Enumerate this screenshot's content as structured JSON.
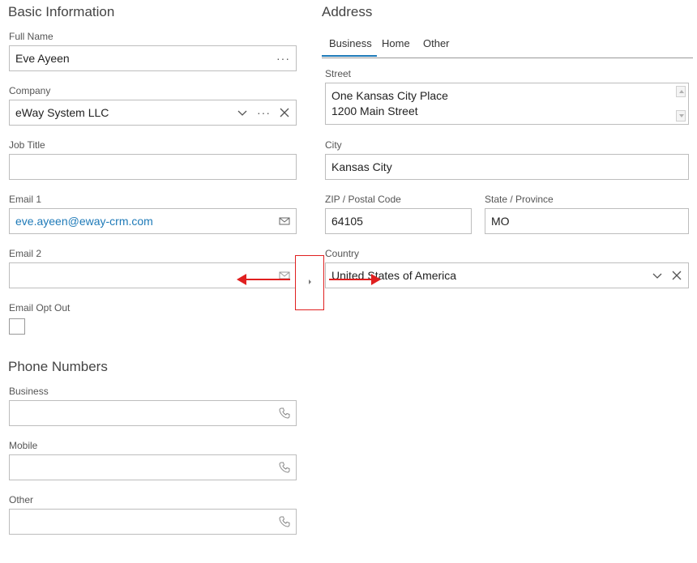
{
  "basic": {
    "title": "Basic Information",
    "full_name": {
      "label": "Full Name",
      "value": "Eve Ayeen"
    },
    "company": {
      "label": "Company",
      "value": "eWay System LLC"
    },
    "job_title": {
      "label": "Job Title",
      "value": ""
    },
    "email1": {
      "label": "Email 1",
      "value": "eve.ayeen@eway-crm.com"
    },
    "email2": {
      "label": "Email 2",
      "value": ""
    },
    "email_opt_out": {
      "label": "Email Opt Out",
      "checked": false
    }
  },
  "phones": {
    "title": "Phone Numbers",
    "business": {
      "label": "Business",
      "value": ""
    },
    "mobile": {
      "label": "Mobile",
      "value": ""
    },
    "other": {
      "label": "Other",
      "value": ""
    }
  },
  "address": {
    "title": "Address",
    "tabs": [
      {
        "label": "Business",
        "active": true
      },
      {
        "label": "Home",
        "active": false
      },
      {
        "label": "Other",
        "active": false
      }
    ],
    "street": {
      "label": "Street",
      "line1": "One Kansas City Place",
      "line2": "1200 Main Street"
    },
    "city": {
      "label": "City",
      "value": "Kansas City"
    },
    "zip": {
      "label": "ZIP / Postal Code",
      "value": "64105"
    },
    "state": {
      "label": "State / Province",
      "value": "MO"
    },
    "country": {
      "label": "Country",
      "value": "United States of America"
    }
  },
  "icons": {
    "more": "more-dots-icon",
    "dropdown": "chevron-down-icon",
    "clear": "close-icon",
    "email": "envelope-icon",
    "phone": "phone-icon"
  },
  "colors": {
    "accent": "#1e7ab8",
    "annotation": "#e02020"
  }
}
